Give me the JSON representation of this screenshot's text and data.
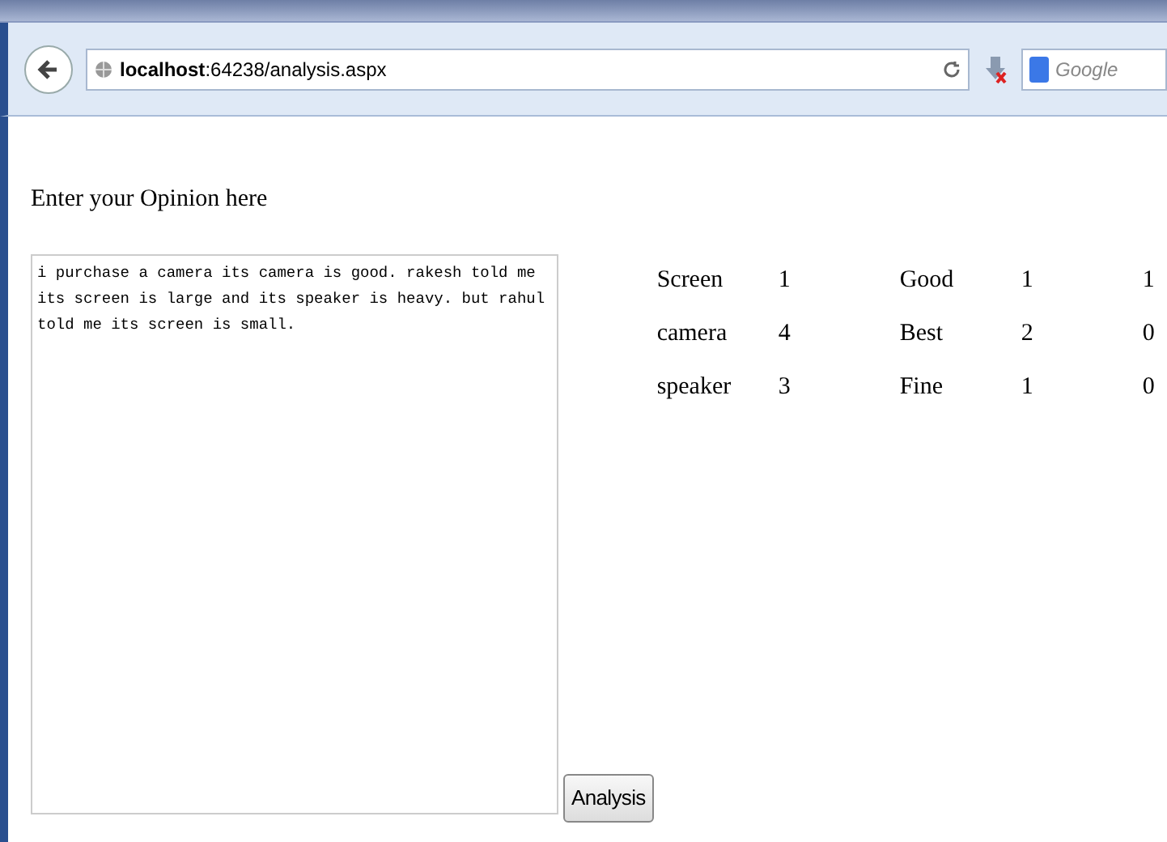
{
  "browser": {
    "address": "**localhost**:64238/analysis.aspx",
    "search_placeholder": "Google"
  },
  "page": {
    "heading": "Enter your Opinion here",
    "opinion": "i purchase a camera its camera is good. rakesh told me its screen is large and its speaker is heavy. but rahul told me its screen is small.",
    "button": "Analysis"
  },
  "table": {
    "rows": [
      {
        "cells": [
          "Screen",
          "1",
          "Good",
          "1",
          "1"
        ]
      },
      {
        "cells": [
          "camera",
          "4",
          "Best",
          "2",
          "0"
        ]
      },
      {
        "cells": [
          "speaker",
          "3",
          "Fine",
          "1",
          "0"
        ]
      }
    ]
  }
}
